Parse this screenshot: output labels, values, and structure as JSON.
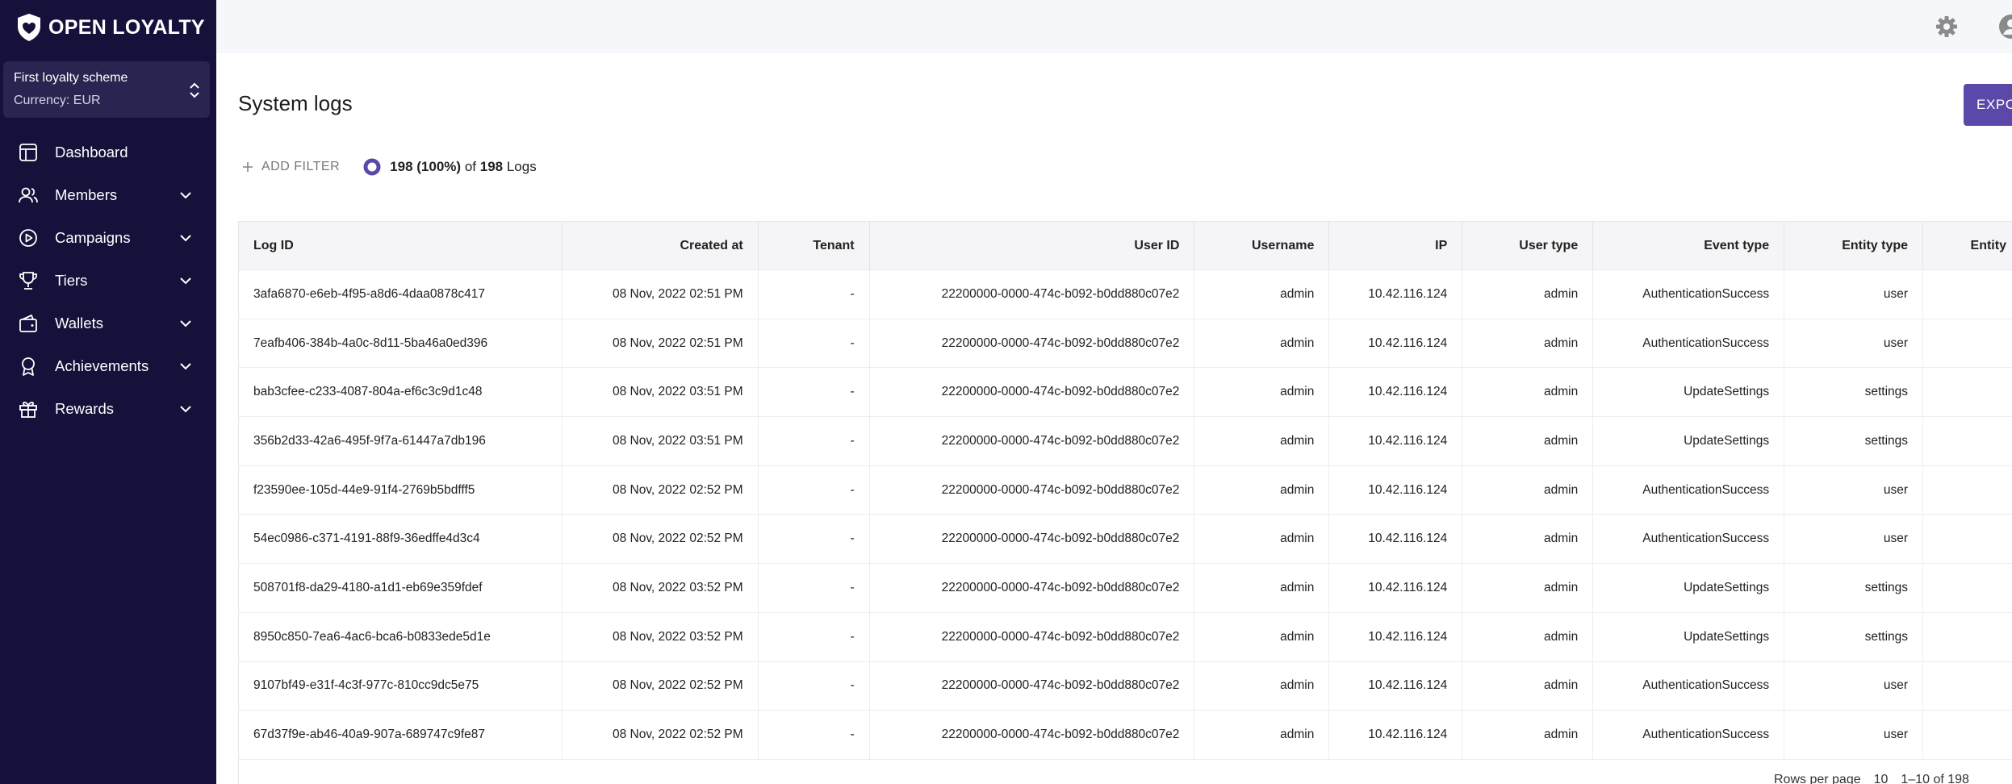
{
  "brand": {
    "name": "OPEN LOYALTY"
  },
  "scheme": {
    "name": "First loyalty scheme",
    "currency": "Currency: EUR"
  },
  "nav": [
    {
      "label": "Dashboard",
      "icon": "dashboard-icon",
      "expandable": false
    },
    {
      "label": "Members",
      "icon": "members-icon",
      "expandable": true
    },
    {
      "label": "Campaigns",
      "icon": "campaigns-icon",
      "expandable": true
    },
    {
      "label": "Tiers",
      "icon": "trophy-icon",
      "expandable": true
    },
    {
      "label": "Wallets",
      "icon": "wallet-icon",
      "expandable": true
    },
    {
      "label": "Achievements",
      "icon": "award-icon",
      "expandable": true
    },
    {
      "label": "Rewards",
      "icon": "gift-icon",
      "expandable": true
    }
  ],
  "page": {
    "title": "System logs",
    "export_label": "EXPO",
    "add_filter_label": "ADD FILTER",
    "count": {
      "shown": "198",
      "percent": "(100%)",
      "of": "of",
      "total": "198",
      "unit": "Logs"
    }
  },
  "colors": {
    "sidebar": "#16113b",
    "accent": "#5b48a8",
    "scheme_box": "#2a2550"
  },
  "table": {
    "headers": [
      "Log ID",
      "Created at",
      "Tenant",
      "User ID",
      "Username",
      "IP",
      "User type",
      "Event type",
      "Entity type",
      "Entity"
    ],
    "rows": [
      [
        "3afa6870-e6eb-4f95-a8d6-4daa0878c417",
        "08 Nov, 2022 02:51 PM",
        "-",
        "22200000-0000-474c-b092-b0dd880c07e2",
        "admin",
        "10.42.116.124",
        "admin",
        "AuthenticationSuccess",
        "user",
        ""
      ],
      [
        "7eafb406-384b-4a0c-8d11-5ba46a0ed396",
        "08 Nov, 2022 02:51 PM",
        "-",
        "22200000-0000-474c-b092-b0dd880c07e2",
        "admin",
        "10.42.116.124",
        "admin",
        "AuthenticationSuccess",
        "user",
        ""
      ],
      [
        "bab3cfee-c233-4087-804a-ef6c3c9d1c48",
        "08 Nov, 2022 03:51 PM",
        "-",
        "22200000-0000-474c-b092-b0dd880c07e2",
        "admin",
        "10.42.116.124",
        "admin",
        "UpdateSettings",
        "settings",
        ""
      ],
      [
        "356b2d33-42a6-495f-9f7a-61447a7db196",
        "08 Nov, 2022 03:51 PM",
        "-",
        "22200000-0000-474c-b092-b0dd880c07e2",
        "admin",
        "10.42.116.124",
        "admin",
        "UpdateSettings",
        "settings",
        ""
      ],
      [
        "f23590ee-105d-44e9-91f4-2769b5bdfff5",
        "08 Nov, 2022 02:52 PM",
        "-",
        "22200000-0000-474c-b092-b0dd880c07e2",
        "admin",
        "10.42.116.124",
        "admin",
        "AuthenticationSuccess",
        "user",
        ""
      ],
      [
        "54ec0986-c371-4191-88f9-36edffe4d3c4",
        "08 Nov, 2022 02:52 PM",
        "-",
        "22200000-0000-474c-b092-b0dd880c07e2",
        "admin",
        "10.42.116.124",
        "admin",
        "AuthenticationSuccess",
        "user",
        ""
      ],
      [
        "508701f8-da29-4180-a1d1-eb69e359fdef",
        "08 Nov, 2022 03:52 PM",
        "-",
        "22200000-0000-474c-b092-b0dd880c07e2",
        "admin",
        "10.42.116.124",
        "admin",
        "UpdateSettings",
        "settings",
        ""
      ],
      [
        "8950c850-7ea6-4ac6-bca6-b0833ede5d1e",
        "08 Nov, 2022 03:52 PM",
        "-",
        "22200000-0000-474c-b092-b0dd880c07e2",
        "admin",
        "10.42.116.124",
        "admin",
        "UpdateSettings",
        "settings",
        ""
      ],
      [
        "9107bf49-e31f-4c3f-977c-810cc9dc5e75",
        "08 Nov, 2022 02:52 PM",
        "-",
        "22200000-0000-474c-b092-b0dd880c07e2",
        "admin",
        "10.42.116.124",
        "admin",
        "AuthenticationSuccess",
        "user",
        ""
      ],
      [
        "67d37f9e-ab46-40a9-907a-689747c9fe87",
        "08 Nov, 2022 02:52 PM",
        "-",
        "22200000-0000-474c-b092-b0dd880c07e2",
        "admin",
        "10.42.116.124",
        "admin",
        "AuthenticationSuccess",
        "user",
        ""
      ]
    ]
  },
  "pagination": {
    "rows_per_page_label": "Rows per page",
    "rows_per_page": "10",
    "range": "1–10 of 198"
  }
}
